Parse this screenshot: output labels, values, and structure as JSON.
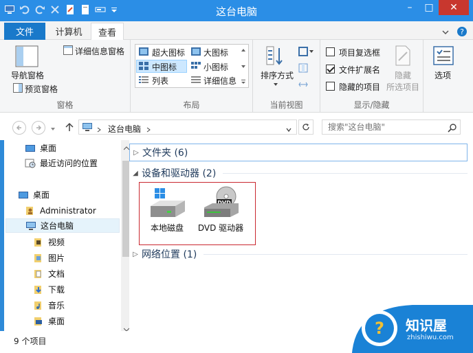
{
  "window": {
    "title": "这台电脑",
    "minimize": "–",
    "maximize": "□",
    "close": "✕"
  },
  "ribbon_tabs": {
    "file": "文件",
    "computer": "计算机",
    "view": "查看"
  },
  "ribbon": {
    "panes": {
      "navigation_pane": "导航窗格",
      "preview_pane": "预览窗格",
      "details_pane": "详细信息窗格",
      "label": "窗格"
    },
    "layout": {
      "extra_large": "超大图标",
      "large": "大图标",
      "medium": "中图标",
      "small": "小图标",
      "list": "列表",
      "details": "详细信息",
      "label": "布局"
    },
    "current_view": {
      "sort_by": "排序方式",
      "label": "当前视图"
    },
    "show_hide": {
      "item_checkboxes": "项目复选框",
      "item_checkboxes_checked": false,
      "file_extensions": "文件扩展名",
      "file_extensions_checked": true,
      "hidden_items": "隐藏的项目",
      "hidden_items_checked": false,
      "hide": "隐藏",
      "selected_items": "所选项目",
      "label": "显示/隐藏"
    },
    "options": "选项"
  },
  "address": {
    "path": "这台电脑",
    "search_placeholder": "搜索\"这台电脑\""
  },
  "nav_pane": {
    "favorites": [
      {
        "label": "桌面"
      },
      {
        "label": "最近访问的位置"
      }
    ],
    "tree": [
      {
        "label": "桌面"
      },
      {
        "label": "Administrator"
      },
      {
        "label": "这台电脑"
      },
      {
        "label": "视频"
      },
      {
        "label": "图片"
      },
      {
        "label": "文档"
      },
      {
        "label": "下载"
      },
      {
        "label": "音乐"
      },
      {
        "label": "桌面"
      }
    ]
  },
  "content": {
    "sections": [
      {
        "label": "文件夹 (6)"
      },
      {
        "label": "设备和驱动器 (2)"
      },
      {
        "label": "网络位置 (1)"
      }
    ],
    "drives": [
      {
        "label": "本地磁盘"
      },
      {
        "label": "DVD 驱动器"
      }
    ]
  },
  "status": {
    "count": "9 个项目"
  },
  "watermark": {
    "name": "知识屋",
    "url": "zhishiwu.com"
  }
}
